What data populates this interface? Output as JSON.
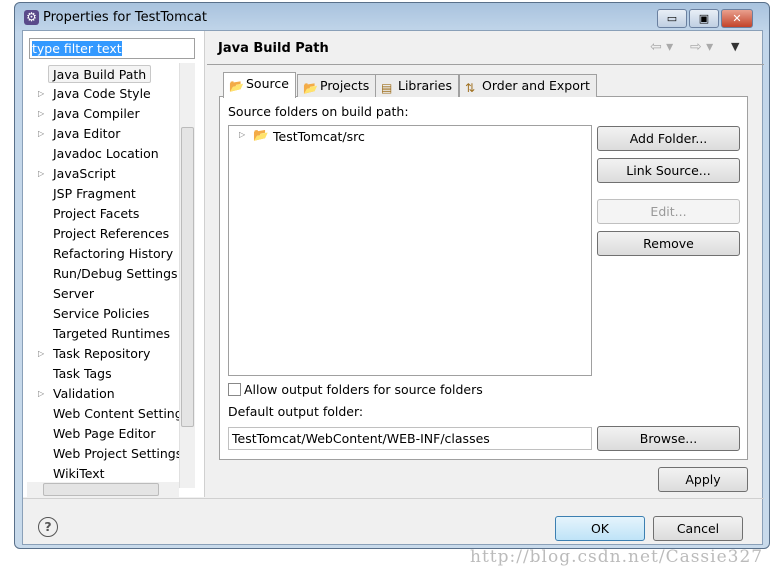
{
  "window": {
    "title": "Properties for TestTomcat",
    "minimize": "▭",
    "maximize": "▣",
    "close": "✕"
  },
  "filter": {
    "value": "type filter text"
  },
  "tree": [
    {
      "label": "Java Build Path",
      "expandable": false,
      "selected": true
    },
    {
      "label": "Java Code Style",
      "expandable": true
    },
    {
      "label": "Java Compiler",
      "expandable": true
    },
    {
      "label": "Java Editor",
      "expandable": true
    },
    {
      "label": "Javadoc Location",
      "expandable": false
    },
    {
      "label": "JavaScript",
      "expandable": true
    },
    {
      "label": "JSP Fragment",
      "expandable": false
    },
    {
      "label": "Project Facets",
      "expandable": false
    },
    {
      "label": "Project References",
      "expandable": false
    },
    {
      "label": "Refactoring History",
      "expandable": false
    },
    {
      "label": "Run/Debug Settings",
      "expandable": false
    },
    {
      "label": "Server",
      "expandable": false
    },
    {
      "label": "Service Policies",
      "expandable": false
    },
    {
      "label": "Targeted Runtimes",
      "expandable": false
    },
    {
      "label": "Task Repository",
      "expandable": true
    },
    {
      "label": "Task Tags",
      "expandable": false
    },
    {
      "label": "Validation",
      "expandable": true
    },
    {
      "label": "Web Content Settings",
      "expandable": false
    },
    {
      "label": "Web Page Editor",
      "expandable": false
    },
    {
      "label": "Web Project Settings",
      "expandable": false
    },
    {
      "label": "WikiText",
      "expandable": false
    }
  ],
  "page": {
    "title": "Java Build Path",
    "tabs": [
      {
        "label": "Source",
        "active": true
      },
      {
        "label": "Projects"
      },
      {
        "label": "Libraries"
      },
      {
        "label": "Order and Export"
      }
    ],
    "source_label": "Source folders on build path:",
    "folders": [
      "TestTomcat/src"
    ],
    "buttons": {
      "add": "Add Folder...",
      "link": "Link Source...",
      "edit": "Edit...",
      "remove": "Remove",
      "browse": "Browse...",
      "apply": "Apply"
    },
    "allow_output": {
      "label": "Allow output folders for source folders",
      "checked": false
    },
    "output_label": "Default output folder:",
    "output_value": "TestTomcat/WebContent/WEB-INF/classes"
  },
  "footer": {
    "help": "?",
    "ok": "OK",
    "cancel": "Cancel"
  },
  "watermark": "http://blog.csdn.net/Cassie327"
}
